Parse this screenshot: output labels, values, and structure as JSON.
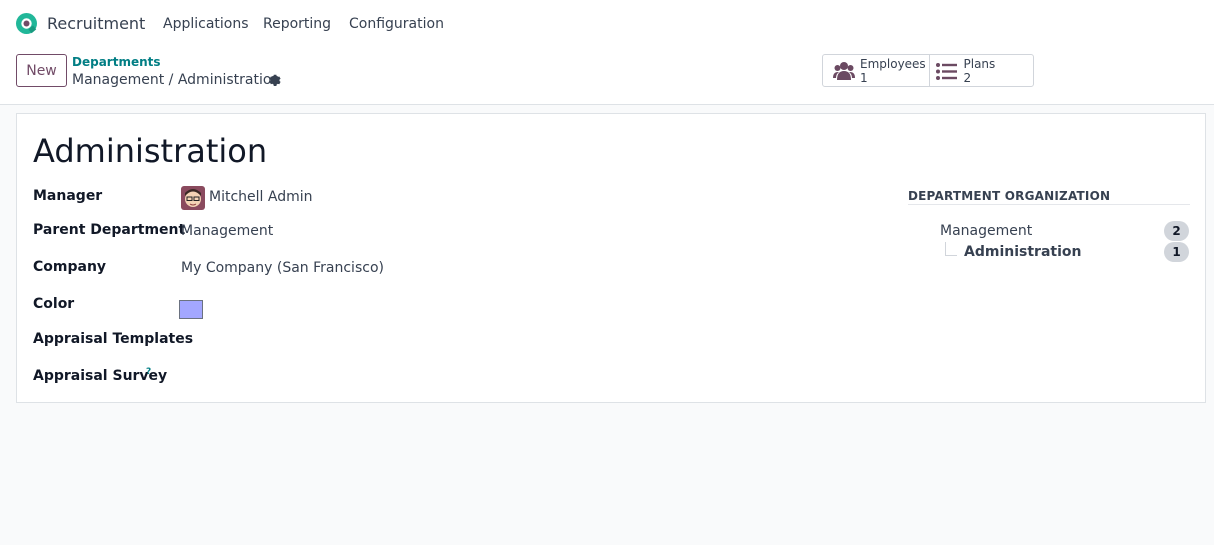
{
  "navbar": {
    "app_name": "Recruitment",
    "menu": [
      "Applications",
      "Reporting",
      "Configuration"
    ]
  },
  "control_panel": {
    "new_label": "New",
    "breadcrumb_parent": "Departments",
    "breadcrumb_current": "Management / Administration",
    "smart_buttons": [
      {
        "label": "Employees",
        "count": "1",
        "icon": "users-icon"
      },
      {
        "label": "Plans",
        "count": "2",
        "icon": "list-icon"
      }
    ]
  },
  "form": {
    "title": "Administration",
    "fields": {
      "manager": {
        "label": "Manager",
        "value": "Mitchell Admin"
      },
      "parent_department": {
        "label": "Parent Department",
        "value": "Management"
      },
      "company": {
        "label": "Company",
        "value": "My Company (San Francisco)"
      },
      "color": {
        "label": "Color",
        "value": "#a3a7ff"
      },
      "appraisal_templates": {
        "label": "Appraisal Templates",
        "value": ""
      },
      "appraisal_survey": {
        "label": "Appraisal Survey",
        "value": "",
        "help": "?"
      }
    }
  },
  "org": {
    "title": "DEPARTMENT ORGANIZATION",
    "parent": {
      "name": "Management",
      "count": "2"
    },
    "child": {
      "name": "Administration",
      "count": "1"
    }
  },
  "colors": {
    "brand": "#714b67",
    "link": "#017e84",
    "logo": "#21b799"
  }
}
